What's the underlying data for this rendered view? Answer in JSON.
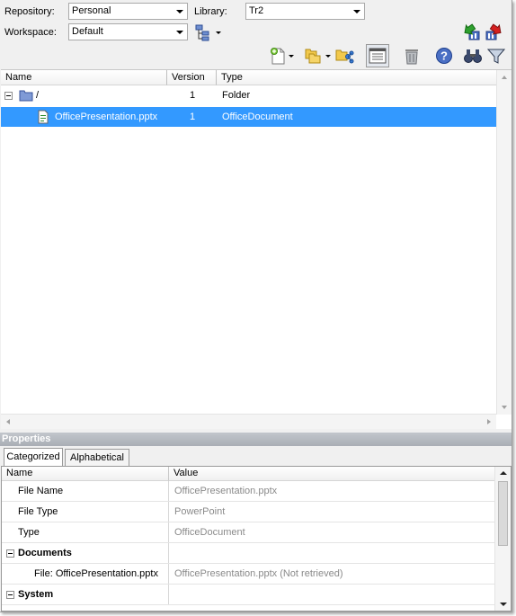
{
  "toolbar": {
    "repository_label": "Repository:",
    "repository_value": "Personal",
    "library_label": "Library:",
    "library_value": "Tr2",
    "workspace_label": "Workspace:",
    "workspace_value": "Default"
  },
  "icons": {
    "check_in": "check-in-icon",
    "check_out": "check-out-icon",
    "hierarchy": "hierarchy-icon",
    "new_document": "new-document-icon",
    "copy": "copy-icon",
    "share_folder": "share-folder-icon",
    "properties_view": "properties-view-icon",
    "delete": "trash-icon",
    "help": "help-icon",
    "search": "binoculars-icon",
    "filter": "filter-icon"
  },
  "file_list": {
    "columns": [
      "Name",
      "Version",
      "Type"
    ],
    "rows": [
      {
        "name": "/",
        "version": "1",
        "type": "Folder",
        "icon": "folder-icon",
        "selected": false
      },
      {
        "name": "OfficePresentation.pptx",
        "version": "1",
        "type": "OfficeDocument",
        "icon": "document-icon",
        "selected": true
      }
    ]
  },
  "properties": {
    "title": "Properties",
    "tabs": [
      "Categorized",
      "Alphabetical"
    ],
    "columns": [
      "Name",
      "Value"
    ],
    "rows": [
      {
        "name": "File Name",
        "value": "OfficePresentation.pptx"
      },
      {
        "name": "File Type",
        "value": "PowerPoint"
      },
      {
        "name": "Type",
        "value": "OfficeDocument"
      }
    ],
    "section_documents": "Documents",
    "documents_row": {
      "name": "File: OfficePresentation.pptx",
      "value": "OfficePresentation.pptx (Not retrieved)"
    },
    "section_system": "System"
  },
  "colors": {
    "selection": "#3399ff",
    "panel": "#f0f0f0",
    "properties_header": "#b5b9bf"
  }
}
